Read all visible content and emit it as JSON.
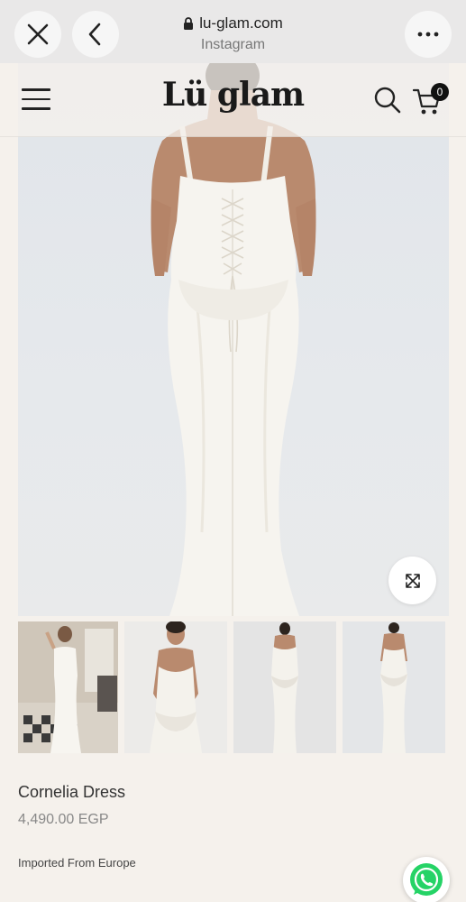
{
  "browser": {
    "url": "lu-glam.com",
    "source": "Instagram",
    "close_icon": "close-icon",
    "back_icon": "chevron-left-icon",
    "more_icon": "more-horizontal-icon"
  },
  "header": {
    "logo": "Lü glam",
    "menu_icon": "hamburger-icon",
    "search_icon": "search-icon",
    "cart_icon": "cart-icon",
    "cart_count": "0"
  },
  "gallery": {
    "main_image": "dress-back-view",
    "zoom_icon": "expand-icon",
    "thumbnails": [
      {
        "name": "dress-lifestyle-photo"
      },
      {
        "name": "dress-front-closeup"
      },
      {
        "name": "dress-front-full"
      },
      {
        "name": "dress-back-full"
      }
    ]
  },
  "product": {
    "title": "Cornelia Dress",
    "price": "4,490.00 EGP",
    "note": "Imported From Europe"
  },
  "colors": {
    "background": "#f5f1ec",
    "whatsapp": "#25d366",
    "dress": "#f6f4ef"
  },
  "chat": {
    "icon": "whatsapp-icon"
  }
}
